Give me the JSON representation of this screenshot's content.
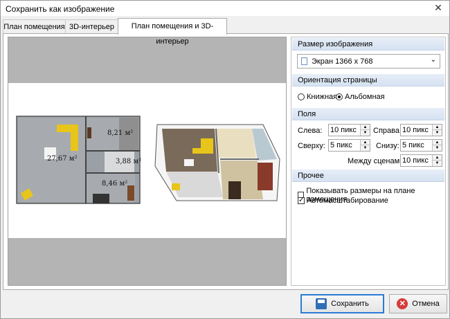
{
  "window": {
    "title": "Сохранить как изображение",
    "close_symbol": "✕"
  },
  "tabs": [
    {
      "label": "План помещения",
      "active": false
    },
    {
      "label": "3D-интерьер",
      "active": false
    },
    {
      "label": "План помещения и 3D-интерьер",
      "active": true
    }
  ],
  "preview": {
    "room_areas": [
      "27,67 м²",
      "8,21 м²",
      "3,88 м²",
      "8,46 м²"
    ]
  },
  "settings": {
    "image_size": {
      "header": "Размер изображения",
      "selected": "Экран 1366 x 768"
    },
    "orientation": {
      "header": "Ориентация страницы",
      "options": [
        {
          "label": "Книжная",
          "checked": false
        },
        {
          "label": "Альбомная",
          "checked": true
        }
      ]
    },
    "margins": {
      "header": "Поля",
      "left_label": "Слева:",
      "left_value": "10 пикс",
      "right_label": "Справа:",
      "right_value": "10 пикс",
      "top_label": "Сверху:",
      "top_value": "5 пикс",
      "bottom_label": "Снизу:",
      "bottom_value": "5 пикс",
      "between_label": "Между сценами:",
      "between_value": "10 пикс"
    },
    "other": {
      "header": "Прочее",
      "options": [
        {
          "label": "Показывать размеры на плане помещения",
          "checked": false
        },
        {
          "label": "Автомасштабирование",
          "checked": true
        }
      ]
    }
  },
  "buttons": {
    "save": "Сохранить",
    "cancel": "Отмена"
  },
  "colors": {
    "accent": "#2b7ad6",
    "section_header": "#dde7f4",
    "preview_bg": "#b4b4b4",
    "sofa": "#e8c51a"
  }
}
